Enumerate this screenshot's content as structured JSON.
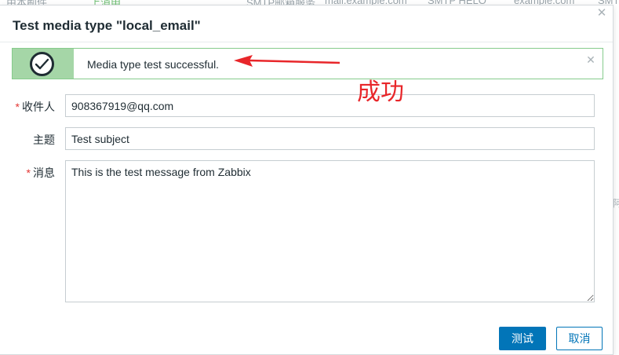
{
  "background": {
    "top_fragments": [
      "由本刷件",
      "上消申",
      "SMTP邮箱服务",
      "mail.example.com",
      "SMTP HELO",
      "example.com",
      "SMTP"
    ],
    "right_fragment": "阿"
  },
  "dialog": {
    "title": "Test media type \"local_email\"",
    "close_icon": "close-icon"
  },
  "banner": {
    "message": "Media type test successful.",
    "icon": "check-circle-icon",
    "close_icon": "close-icon",
    "color": "#a5d6a7"
  },
  "annotation": {
    "text": "成功",
    "color": "#e8262a"
  },
  "form": {
    "recipient": {
      "label": "收件人",
      "required": "*",
      "value": "908367919@qq.com"
    },
    "subject": {
      "label": "主题",
      "value": "Test subject"
    },
    "message": {
      "label": "消息",
      "required": "*",
      "value": "This is the test message from Zabbix"
    }
  },
  "footer": {
    "test_button": "测试",
    "cancel_button": "取消",
    "accent_color": "#0275b8"
  }
}
